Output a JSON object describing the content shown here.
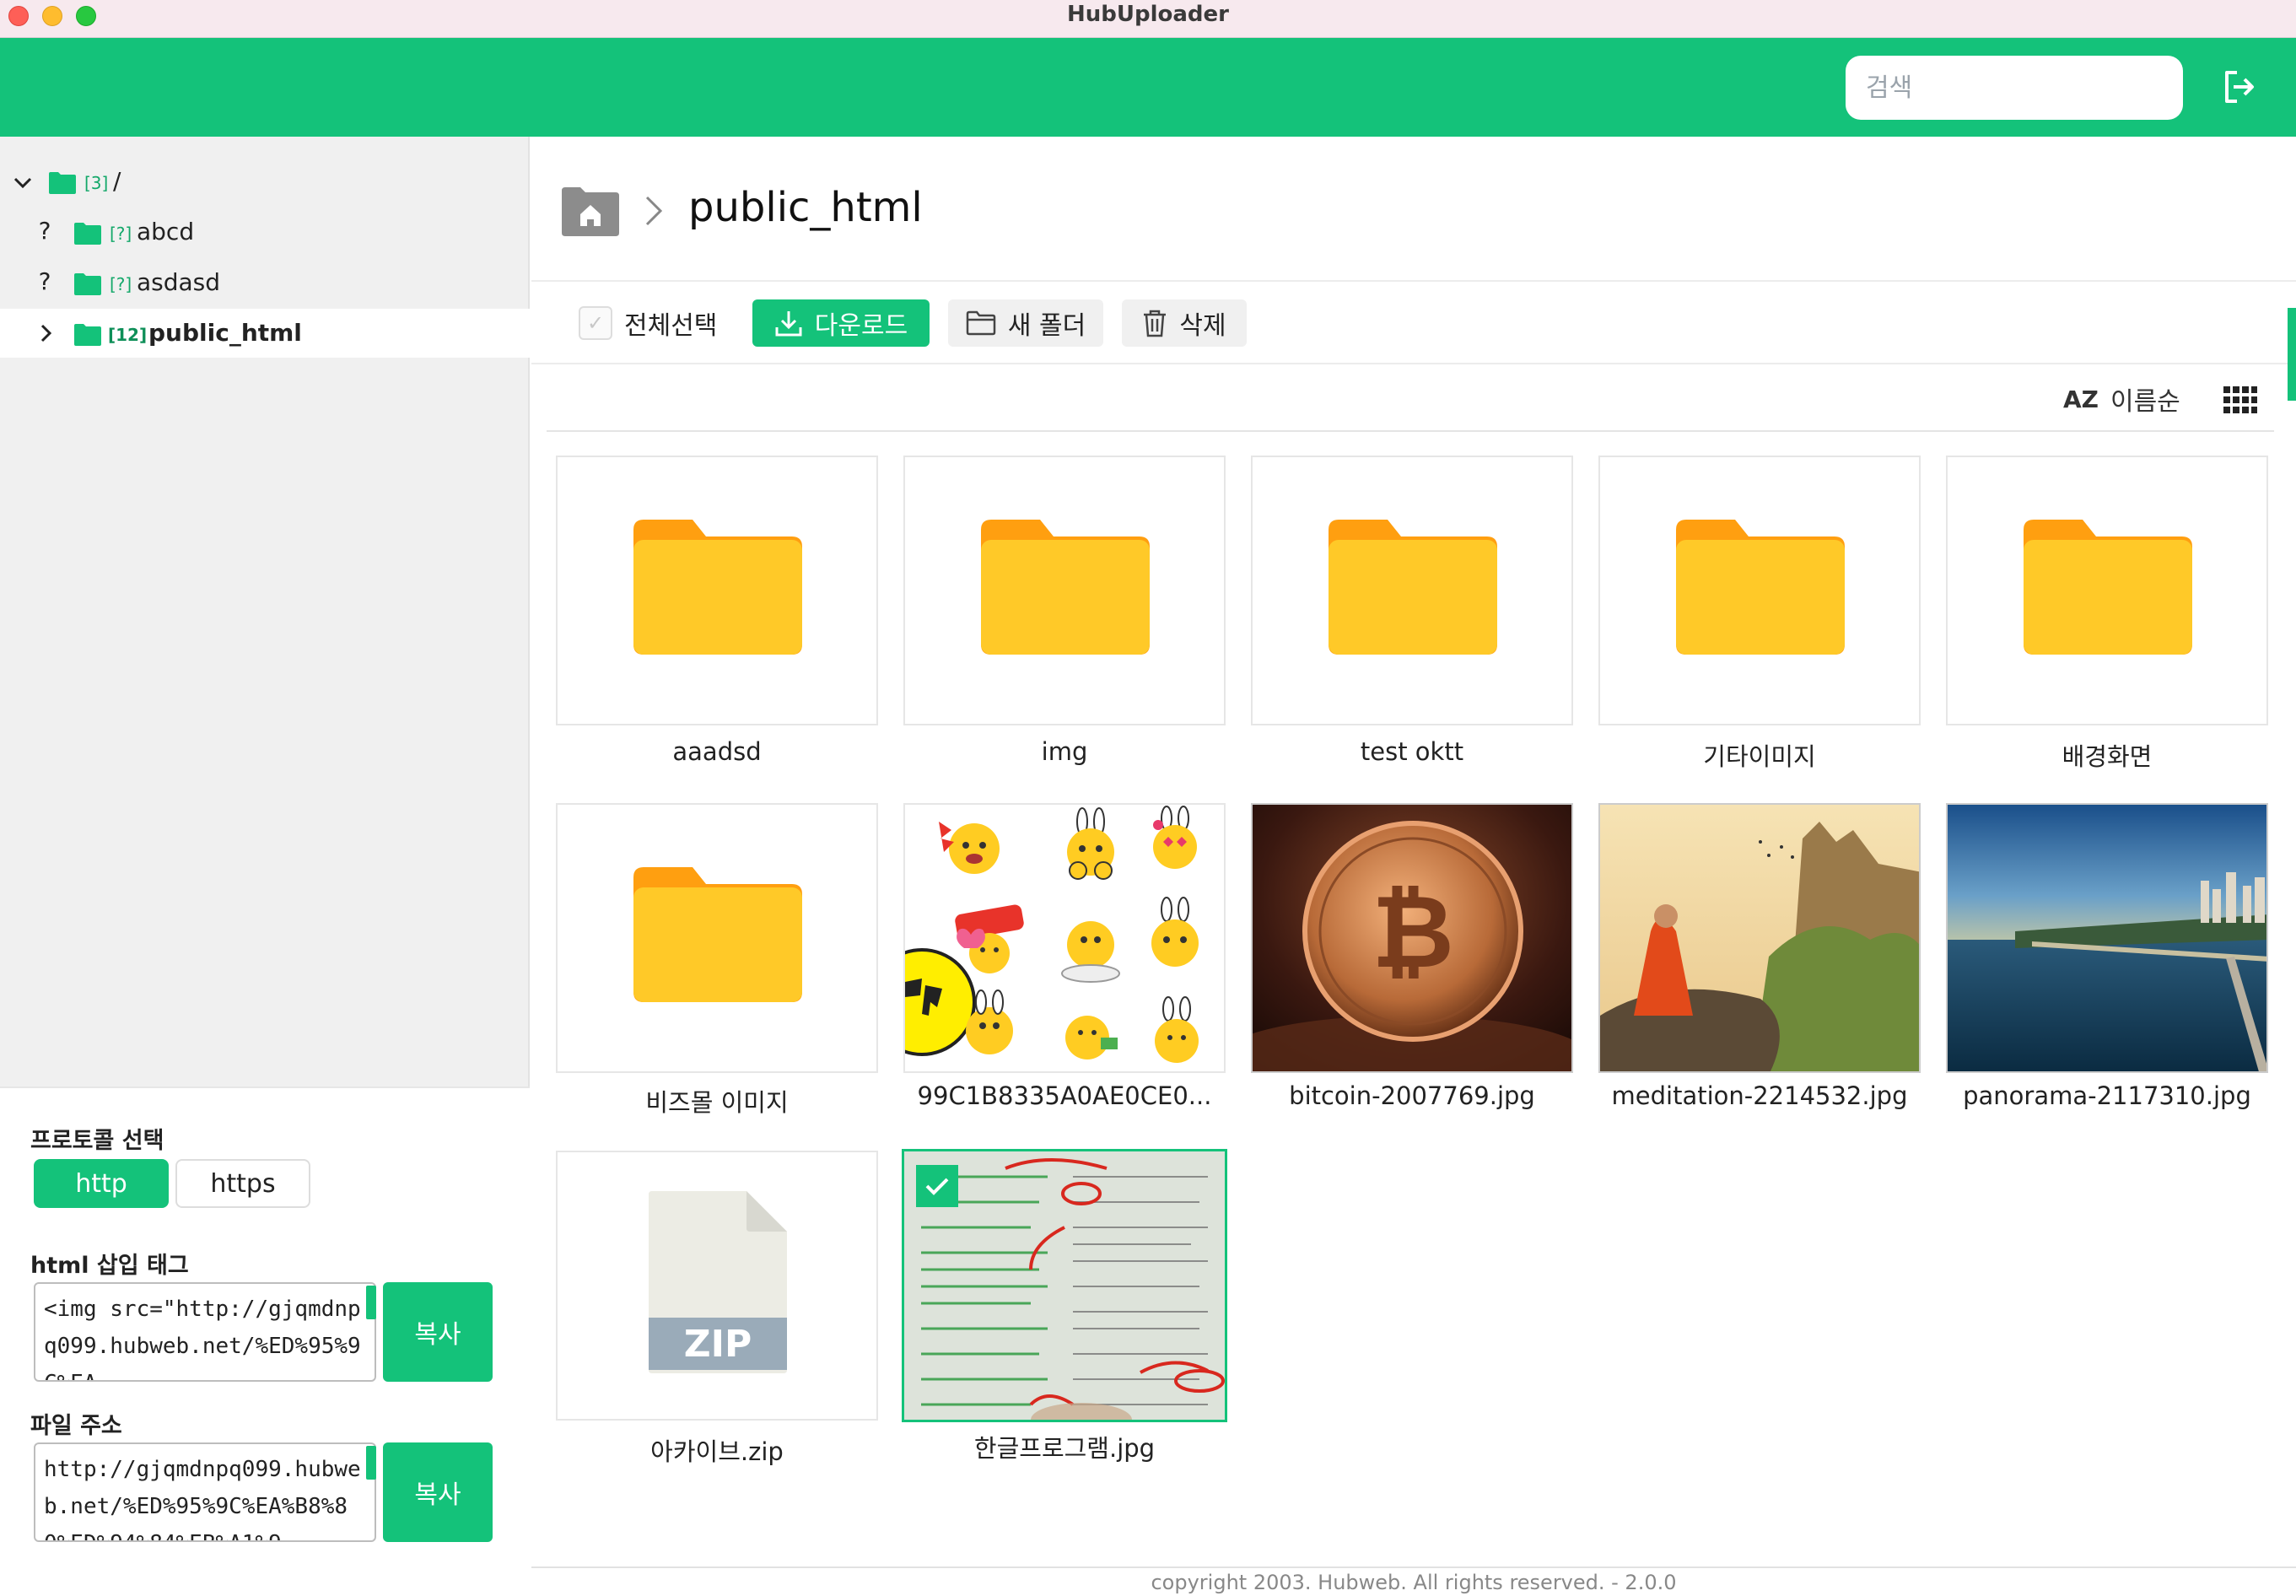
{
  "window": {
    "title": "HubUploader"
  },
  "header": {
    "search_placeholder": "검색",
    "logout_icon": "logout-icon"
  },
  "tree": {
    "root": {
      "toggle": "⌄",
      "count": "[3]",
      "label": "/"
    },
    "items": [
      {
        "toggle": "?",
        "count": "[?]",
        "label": "abcd",
        "active": false
      },
      {
        "toggle": "?",
        "count": "[?]",
        "label": "asdasd",
        "active": false
      },
      {
        "toggle": "›",
        "count": "[12]",
        "label": "public_html",
        "active": true
      }
    ]
  },
  "breadcrumb": {
    "current": "public_html",
    "separator": "›"
  },
  "toolbar": {
    "select_all": "전체선택",
    "download": "다운로드",
    "new_folder": "새 폴더",
    "delete": "삭제"
  },
  "sort": {
    "icon_text": "AZ",
    "label": "이름순"
  },
  "files": [
    {
      "name": "aaadsd",
      "kind": "folder"
    },
    {
      "name": "img",
      "kind": "folder"
    },
    {
      "name": "test oktt",
      "kind": "folder"
    },
    {
      "name": "기타이미지",
      "kind": "folder"
    },
    {
      "name": "배경화면",
      "kind": "folder"
    },
    {
      "name": "비즈몰 이미지",
      "kind": "folder"
    },
    {
      "name": "99C1B8335A0AE0CE0...",
      "kind": "image-stickers"
    },
    {
      "name": "bitcoin-2007769.jpg",
      "kind": "image-coin"
    },
    {
      "name": "meditation-2214532.jpg",
      "kind": "image-meditation"
    },
    {
      "name": "panorama-2117310.jpg",
      "kind": "image-panorama"
    },
    {
      "name": "아카이브.zip",
      "kind": "zip",
      "badge": "ZIP"
    },
    {
      "name": "한글프로그램.jpg",
      "kind": "image-receipt",
      "selected": true
    }
  ],
  "panel": {
    "protocol_label": "프로토콜 선택",
    "protocols": [
      "http",
      "https"
    ],
    "selected_protocol": "http",
    "html_tag_label": "html 삽입 태그",
    "html_tag_value": "<img src=\"http://gjqmdnpq099.hubweb.net/%ED%95%9C%EA",
    "file_url_label": "파일 주소",
    "file_url_value": "http://gjqmdnpq099.hubweb.net/%ED%95%9C%EA%B8%80%ED%94%84%EB%A1%9",
    "copy_label": "복사"
  },
  "footer": {
    "text": "copyright 2003. Hubweb. All rights reserved. - 2.0.0"
  },
  "colors": {
    "accent": "#14c27a",
    "folder": "#ffc928",
    "folder_tab": "#ff9f10",
    "zip_badge": "#9aabb9"
  }
}
